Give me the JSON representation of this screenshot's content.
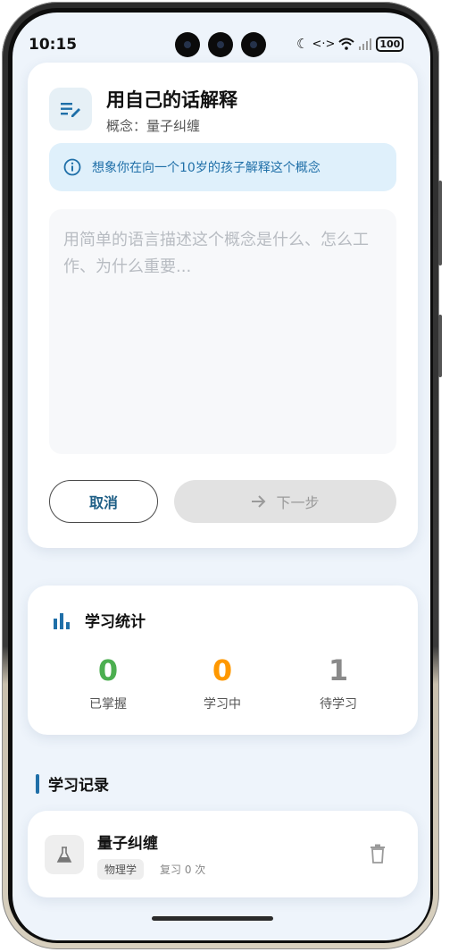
{
  "status_bar": {
    "time": "10:15",
    "battery": "100"
  },
  "explain_card": {
    "title": "用自己的话解释",
    "concept_label": "概念：",
    "concept_value": "量子纠缠",
    "hint": "想象你在向一个10岁的孩子解释这个概念",
    "input_placeholder": "用简单的语言描述这个概念是什么、怎么工作、为什么重要...",
    "cancel_label": "取消",
    "next_label": "下一步"
  },
  "stats": {
    "title": "学习统计",
    "items": [
      {
        "value": "0",
        "label": "已掌握",
        "color": "#4caf50"
      },
      {
        "value": "0",
        "label": "学习中",
        "color": "#ff9800"
      },
      {
        "value": "1",
        "label": "待学习",
        "color": "#8a8a8a"
      }
    ]
  },
  "records": {
    "section_title": "学习记录",
    "items": [
      {
        "title": "量子纠缠",
        "tag": "物理学",
        "meta": "复习 0 次"
      }
    ]
  },
  "colors": {
    "accent": "#1f6fa8",
    "background": "#eef4fb"
  },
  "icons": {
    "header": "edit-note-icon",
    "hint": "info-icon",
    "next": "arrow-right-icon",
    "stats": "bar-chart-icon",
    "record": "flask-icon",
    "delete": "trash-icon"
  }
}
